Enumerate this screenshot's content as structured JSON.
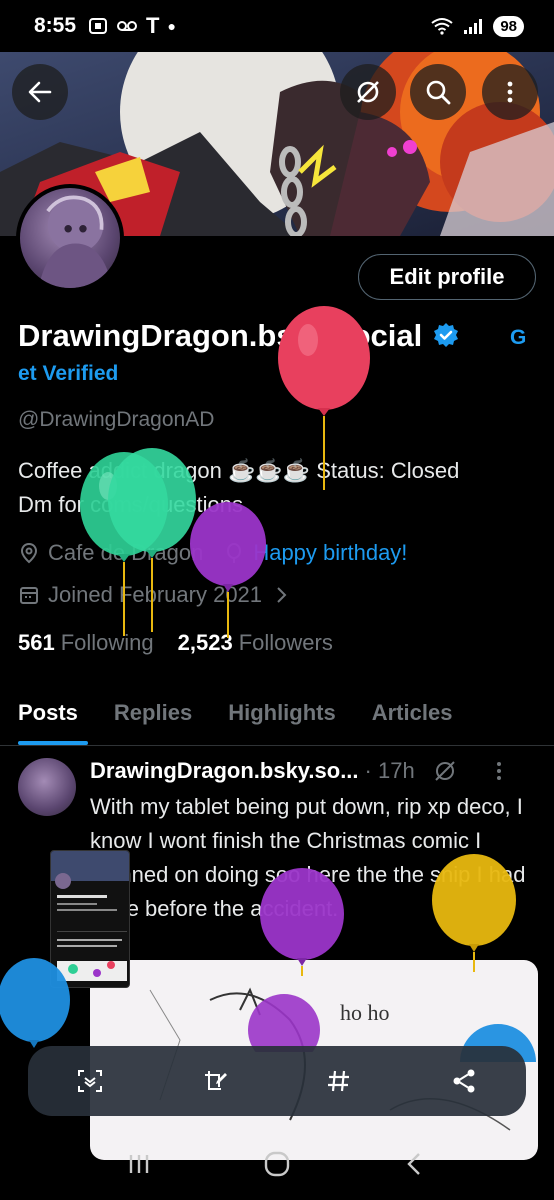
{
  "status_bar": {
    "time": "8:55",
    "carrier_icon": "T",
    "battery": "98"
  },
  "profile": {
    "display_name_part1": "DrawingDragon.",
    "display_name_part2": "bsky",
    "display_name_part3": ".social",
    "get_verified_1": "G",
    "get_verified_2": "et Verified",
    "handle": "@DrawingDragonAD",
    "bio_line1": "Coffee addict dragon ☕☕☕ Status: Closed",
    "bio_line2": "Dm for coms/questions",
    "location": "Cafe de Dragon",
    "birthday": "Happy birthday!",
    "joined": "Joined February 2021",
    "following_count": "561",
    "following_label": "Following",
    "followers_count": "2,523",
    "followers_label": "Followers",
    "edit_profile": "Edit profile"
  },
  "tabs": [
    "Posts",
    "Replies",
    "Highlights",
    "Articles"
  ],
  "post": {
    "author": "DrawingDragon.bsky.so...",
    "time": "· 17h",
    "text": "With my tablet being put down, rip xp deco, I know I wont finish the Christmas comic I planned on doing soo here the the snip I had done before the accident.",
    "image_text": "ho ho"
  },
  "colors": {
    "accent": "#1d9bf0",
    "balloon_red": "#e8405e",
    "balloon_green": "#2ecf95",
    "balloon_purple": "#9b35c9",
    "balloon_yellow": "#e8b80f",
    "balloon_blue": "#1f8fe0"
  }
}
